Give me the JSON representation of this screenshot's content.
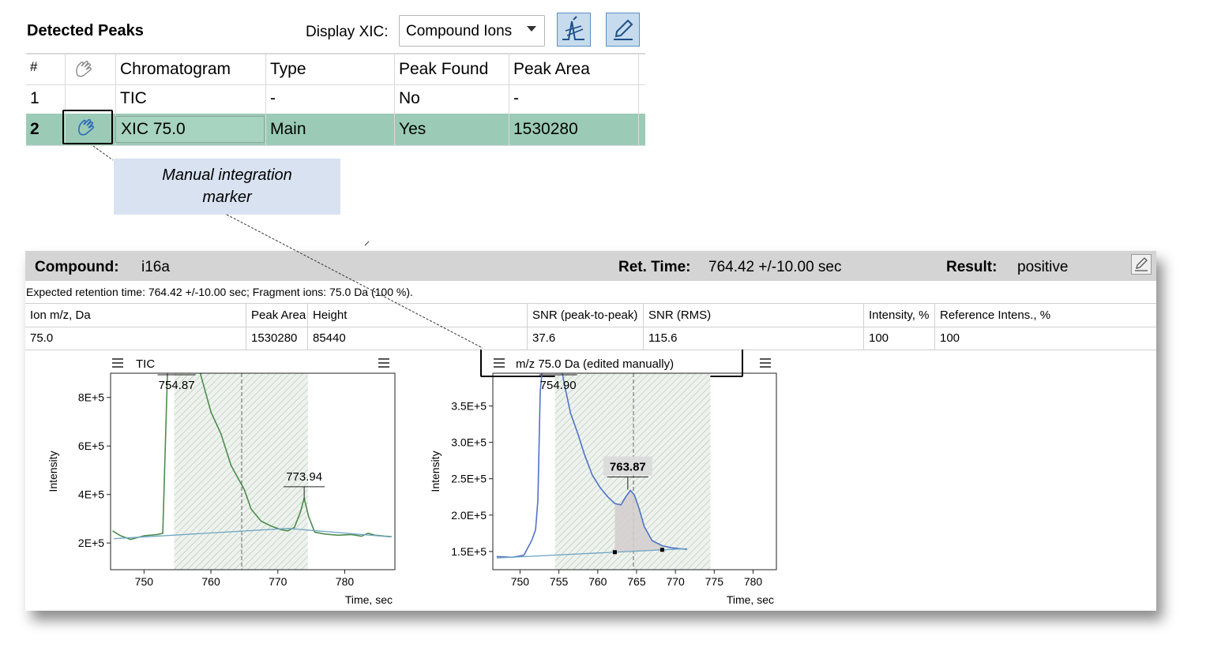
{
  "detected_peaks": {
    "title": "Detected Peaks",
    "display_xic_label": "Display XIC:",
    "display_xic_value": "Compound Ions",
    "columns": [
      "#",
      "",
      "Chromatogram",
      "Type",
      "Peak Found",
      "Peak Area"
    ],
    "rows": [
      {
        "num": "1",
        "chromatogram": "TIC",
        "type": "-",
        "found": "No",
        "area": "-",
        "selected": false,
        "manual": false
      },
      {
        "num": "2",
        "chromatogram": "XIC 75.0",
        "type": "Main",
        "found": "Yes",
        "area": "1530280",
        "selected": true,
        "manual": true
      }
    ],
    "icons": [
      "hand-icon",
      "peak-tool-icon",
      "edit-pencil-icon"
    ],
    "selected_row_color": "#9bcbb6"
  },
  "callout": {
    "line1": "Manual integration",
    "line2": "marker"
  },
  "result_panel": {
    "compound_label": "Compound:",
    "compound_value": "i16a",
    "ret_time_label": "Ret. Time:",
    "ret_time_value": "764.42 +/-10.00 sec",
    "result_label": "Result:",
    "result_value": "positive",
    "expected_text": "Expected retention time: 764.42 +/-10.00 sec; Fragment ions: 75.0 Da (100 %).",
    "fragment_columns": [
      "Ion m/z, Da",
      "Peak Area",
      "Height",
      "SNR (peak-to-peak)",
      "SNR (RMS)",
      "Intensity, %",
      "Reference Intens., %"
    ],
    "fragment_row": [
      "75.0",
      "1530280",
      "85440",
      "37.6",
      "115.6",
      "100",
      "100"
    ]
  },
  "chart_data": [
    {
      "type": "line",
      "title": "TIC",
      "xlabel": "Time, sec",
      "ylabel": "Intensity",
      "xlim": [
        745,
        787.5
      ],
      "ylim": [
        90000,
        900000
      ],
      "x_ticks": [
        "750",
        "760",
        "770",
        "780"
      ],
      "y_ticks": [
        "2E+5",
        "4E+5",
        "6E+5",
        "8E+5"
      ],
      "integration_window": [
        754.5,
        774.5
      ],
      "peak_marker": 764.6,
      "annotations": [
        {
          "label": "754.87",
          "x": 754.87
        },
        {
          "label": "773.94",
          "x": 773.94,
          "y": 380000
        }
      ],
      "series": [
        {
          "color": "#4c8c4c",
          "points": [
            [
              745.3,
              250000
            ],
            [
              746.5,
              230000
            ],
            [
              748,
              215000
            ],
            [
              750,
              230000
            ],
            [
              752,
              235000
            ],
            [
              752.8,
              240000
            ],
            [
              753.5,
              900000
            ],
            [
              754.5,
              950000
            ],
            [
              755.2,
              1200000
            ],
            [
              756.5,
              1200000
            ],
            [
              757.5,
              1000000
            ],
            [
              758.5,
              890000
            ],
            [
              760,
              740000
            ],
            [
              761.5,
              650000
            ],
            [
              763,
              520000
            ],
            [
              764,
              470000
            ],
            [
              765,
              420000
            ],
            [
              766,
              340000
            ],
            [
              767.5,
              290000
            ],
            [
              769,
              270000
            ],
            [
              770.5,
              255000
            ],
            [
              771.5,
              250000
            ],
            [
              772.5,
              265000
            ],
            [
              773.4,
              330000
            ],
            [
              773.94,
              385000
            ],
            [
              774.6,
              310000
            ],
            [
              775.5,
              245000
            ],
            [
              777,
              237000
            ],
            [
              779,
              232000
            ],
            [
              781,
              235000
            ],
            [
              782.5,
              228000
            ],
            [
              783.5,
              240000
            ],
            [
              784.5,
              232000
            ],
            [
              786,
              228000
            ],
            [
              787,
              226000
            ]
          ]
        },
        {
          "color": "#6fa6c4",
          "points": [
            [
              745.5,
              218000
            ],
            [
              771.5,
              260000
            ],
            [
              787,
              225000
            ]
          ]
        }
      ]
    },
    {
      "type": "line",
      "title": "m/z 75.0 Da (edited manually)",
      "xlabel": "Time, sec",
      "ylabel": "Intensity",
      "xlim": [
        746.5,
        783
      ],
      "ylim": [
        125000,
        395000
      ],
      "x_ticks": [
        "750",
        "755",
        "760",
        "765",
        "770",
        "775",
        "780"
      ],
      "y_ticks": [
        "1.5E+5",
        "2.0E+5",
        "2.5E+5",
        "3.0E+5",
        "3.5E+5"
      ],
      "integration_window": [
        754.5,
        774.5
      ],
      "manual_window": [
        762.2,
        768.3
      ],
      "peak_marker": 764.6,
      "annotations": [
        {
          "label": "754.90",
          "x": 754.9
        },
        {
          "label": "763.87",
          "x": 763.87,
          "y": 235000
        }
      ],
      "series": [
        {
          "color": "#4f72c8",
          "points": [
            [
              747,
              143000
            ],
            [
              749,
              142000
            ],
            [
              750.5,
              145000
            ],
            [
              751.5,
              165000
            ],
            [
              752,
              180000
            ],
            [
              752.3,
              220000
            ],
            [
              752.6,
              370000
            ],
            [
              753.3,
              450000
            ],
            [
              754.5,
              450000
            ],
            [
              755.7,
              380000
            ],
            [
              756.5,
              340000
            ],
            [
              757.5,
              310000
            ],
            [
              758.3,
              283000
            ],
            [
              759.3,
              255000
            ],
            [
              760.3,
              238000
            ],
            [
              761.3,
              225000
            ],
            [
              762.2,
              216000
            ],
            [
              763,
              214000
            ],
            [
              763.6,
              225000
            ],
            [
              764.2,
              234000
            ],
            [
              764.7,
              228000
            ],
            [
              765.3,
              210000
            ],
            [
              766,
              184000
            ],
            [
              767,
              165000
            ],
            [
              768.3,
              158000
            ],
            [
              769.5,
              155000
            ],
            [
              770.5,
              154000
            ],
            [
              771.5,
              153000
            ]
          ]
        },
        {
          "color": "#6fa6c4",
          "points": [
            [
              747,
              141000
            ],
            [
              771.5,
              154000
            ]
          ]
        }
      ]
    }
  ]
}
